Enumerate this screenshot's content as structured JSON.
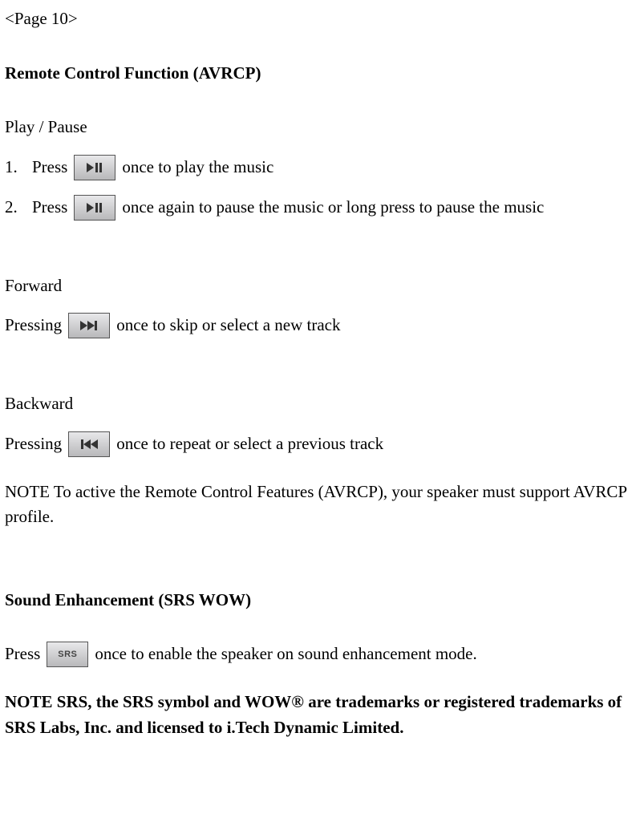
{
  "page_tag": "<Page 10>",
  "section1": {
    "heading": "Remote Control Function (AVRCP)",
    "play_pause": {
      "title": "Play / Pause",
      "item1_num": "1.",
      "item1_before": "Press",
      "item1_after": "once to play the music",
      "item2_num": "2.",
      "item2_before": "Press",
      "item2_after": "once again to pause the music or long press to pause the music"
    },
    "forward": {
      "title": "Forward",
      "before": "Pressing",
      "after": "once to skip or select a new track"
    },
    "backward": {
      "title": "Backward",
      "before": "Pressing",
      "after": "once to repeat or select a previous track"
    },
    "note": "NOTE      To active the Remote Control Features (AVRCP), your speaker must support AVRCP profile."
  },
  "section2": {
    "heading": "Sound Enhancement (SRS WOW)",
    "before": "Press",
    "srs_label": "SRS",
    "after": "once to enable the speaker on sound enhancement mode.",
    "note": "NOTE     SRS, the SRS symbol and WOW® are trademarks or registered trademarks of SRS Labs, Inc. and licensed to i.Tech Dynamic Limited."
  }
}
